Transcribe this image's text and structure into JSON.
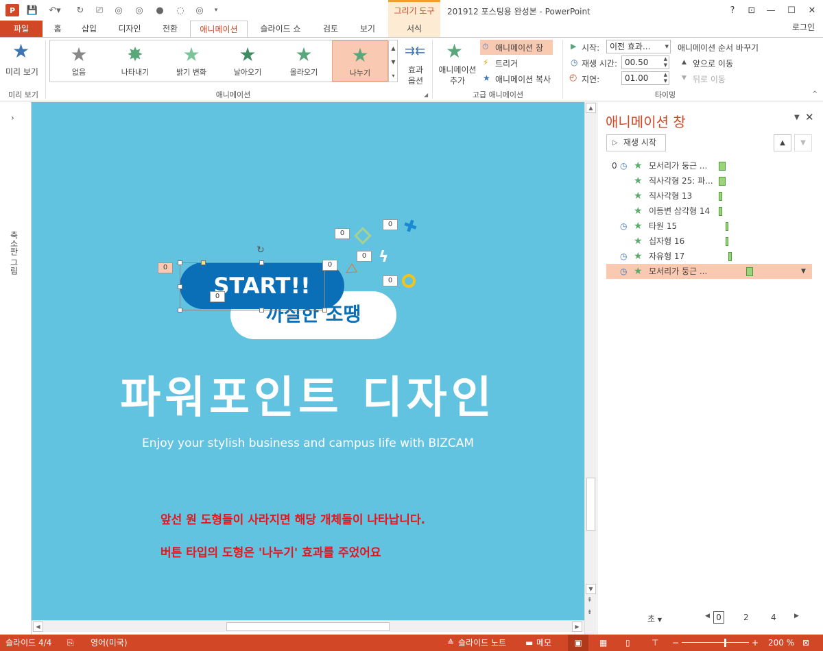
{
  "window": {
    "app_icon": "P",
    "context_tab_group": "그리기 도구",
    "title": "201912 포스팅용 완성본 - PowerPoint",
    "help": "?",
    "login": "로그인"
  },
  "tabs": [
    "파일",
    "홈",
    "삽입",
    "디자인",
    "전환",
    "애니메이션",
    "슬라이드 쇼",
    "검토",
    "보기",
    "서식"
  ],
  "ribbon": {
    "preview_label": "미리 보기",
    "preview_group": "미리 보기",
    "animation_group": "애니메이션",
    "gallery": [
      "없음",
      "나타내기",
      "밝기 변화",
      "날아오기",
      "올라오기",
      "나누기"
    ],
    "effect_options": "효과 옵션",
    "add_animation": "애니메이션 추가",
    "anim_pane_btn": "애니메이션 창",
    "trigger": "트리거",
    "anim_painter": "애니메이션 복사",
    "advanced_group": "고급 애니메이션",
    "start_label": "시작:",
    "start_value": "이전 효과...",
    "duration_label": "재생 시간:",
    "duration_value": "00.50",
    "delay_label": "지연:",
    "delay_value": "01.00",
    "reorder_label": "애니메이션 순서 바꾸기",
    "move_earlier": "앞으로 이동",
    "move_later": "뒤로 이동",
    "timing_group": "타이밍"
  },
  "leftpane": {
    "label": "축소판 그림"
  },
  "slide": {
    "start_btn": "START!!",
    "pill_text": "까실한 조땡",
    "title": "파워포인트 디자인",
    "subtitle": "Enjoy your stylish business and campus life with BIZCAM",
    "note1": "앞선 원 도형들이 사라지면 해당 개체들이 나타납니다.",
    "note2": "버튼 타입의 도형은 '나누기' 효과를 주었어요",
    "tags": [
      "0",
      "0",
      "0",
      "0",
      "0",
      "0",
      "0"
    ]
  },
  "anim_pane": {
    "title": "애니메이션 창",
    "play": "재생 시작",
    "items": [
      {
        "num": "0",
        "clock": true,
        "name": "모서리가 둥근 ..."
      },
      {
        "num": "",
        "clock": false,
        "name": "직사각형 25: 파..."
      },
      {
        "num": "",
        "clock": false,
        "name": "직사각형 13"
      },
      {
        "num": "",
        "clock": false,
        "name": "이등변 삼각형 14"
      },
      {
        "num": "",
        "clock": true,
        "name": "타원 15"
      },
      {
        "num": "",
        "clock": false,
        "name": "십자형 16"
      },
      {
        "num": "",
        "clock": true,
        "name": "자유형 17"
      },
      {
        "num": "",
        "clock": true,
        "name": "모서리가 둥근 ..."
      }
    ],
    "seconds_label": "초",
    "timeline": [
      "0",
      "2",
      "4"
    ]
  },
  "status": {
    "slide": "슬라이드 4/4",
    "lang": "영어(미국)",
    "notes": "슬라이드 노트",
    "comments": "메모",
    "zoom": "200 %"
  },
  "colors": {
    "accent": "#d24726",
    "slide_bg": "#62c3e1",
    "start_btn": "#0b6fb8",
    "note_red": "#e8141c"
  }
}
